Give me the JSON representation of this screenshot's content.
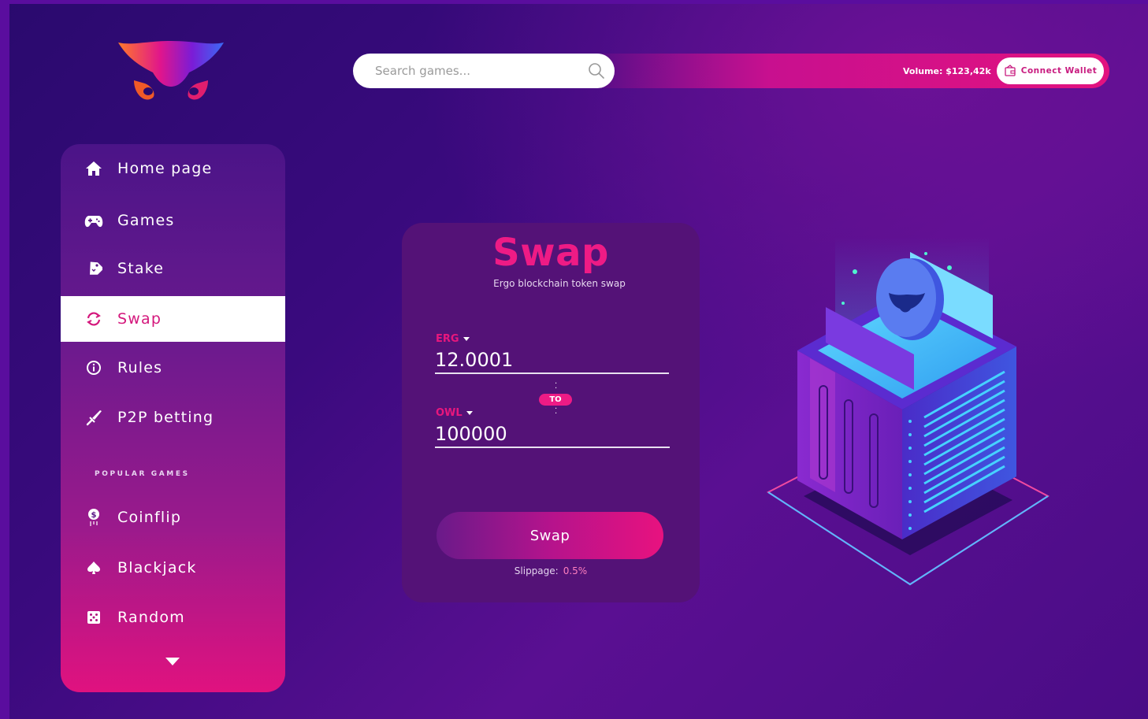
{
  "header": {
    "search": {
      "placeholder": "Search games..."
    },
    "volume_label": "Volume: $123,42k",
    "connect_wallet_label": "Connect Wallet"
  },
  "sidebar": {
    "items": [
      {
        "label": "Home page",
        "icon": "home-icon"
      },
      {
        "label": "Games",
        "icon": "gamepad-icon"
      },
      {
        "label": "Stake",
        "icon": "tag-icon"
      },
      {
        "label": "Swap",
        "icon": "refresh-icon",
        "active": true
      },
      {
        "label": "Rules",
        "icon": "info-icon"
      },
      {
        "label": "P2P betting",
        "icon": "sword-icon"
      }
    ],
    "section_title": "POPULAR GAMES",
    "games": [
      {
        "label": "Coinflip",
        "icon": "coin-icon"
      },
      {
        "label": "Blackjack",
        "icon": "spade-icon"
      },
      {
        "label": "Random",
        "icon": "dice-icon"
      }
    ]
  },
  "swap": {
    "title": "Swap",
    "subtitle": "Ergo blockchain token swap",
    "from": {
      "token": "ERG",
      "amount": "12.0001"
    },
    "to_label": "TO",
    "to": {
      "token": "OWL",
      "amount": "100000"
    },
    "button_label": "Swap",
    "slippage_label": "Slippage:",
    "slippage_value": "0.5%"
  },
  "colors": {
    "accent": "#ee1b85",
    "background": "#3a0a7e",
    "sidebar_top": "#4b1488",
    "sidebar_bottom": "#e0127f"
  }
}
